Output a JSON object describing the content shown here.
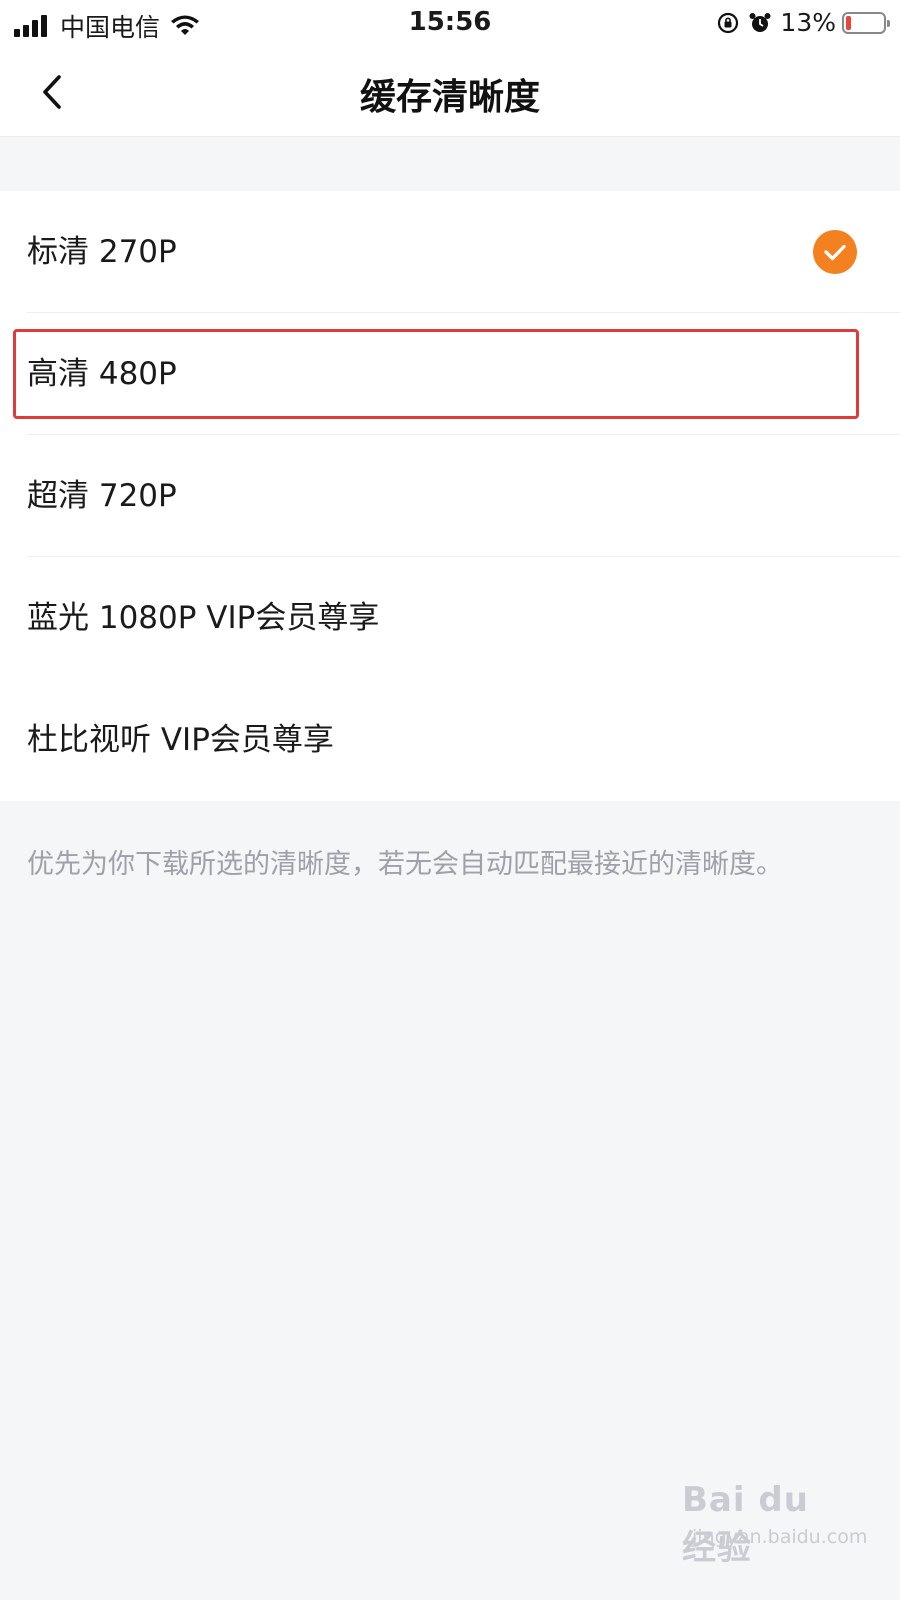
{
  "status_bar": {
    "carrier": "中国电信",
    "time": "15:56",
    "battery": "13%",
    "battery_level": 0.13,
    "icons": [
      "signal-icon",
      "wifi-icon",
      "orientation-lock-icon",
      "alarm-icon",
      "battery-icon"
    ]
  },
  "nav": {
    "title": "缓存清晰度",
    "back_icon": "chevron-left-icon"
  },
  "options": [
    {
      "label": "标清 270P",
      "selected": true
    },
    {
      "label": "高清 480P",
      "selected": false,
      "highlighted": true
    },
    {
      "label": "超清 720P",
      "selected": false
    },
    {
      "label": "蓝光 1080P VIP会员尊享",
      "selected": false
    },
    {
      "label": "杜比视听 VIP会员尊享",
      "selected": false
    }
  ],
  "footnote": "优先为你下载所选的清晰度，若无会自动匹配最接近的清晰度。",
  "colors": {
    "accent": "#f4811f",
    "highlight": "#e03b3b",
    "background": "#f5f6f8",
    "footnote_text": "#9ea1a8"
  },
  "watermark": {
    "main": "Bai du 经验",
    "sub": "jingyan.baidu.com"
  }
}
